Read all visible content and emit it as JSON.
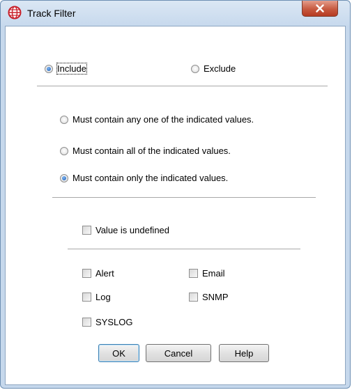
{
  "window": {
    "title": "Track Filter"
  },
  "mode": {
    "include_label": "Include",
    "exclude_label": "Exclude",
    "selected": "Include"
  },
  "match": {
    "options": [
      "Must contain any one of the indicated values.",
      "Must contain all of the indicated values.",
      "Must contain only the indicated values."
    ],
    "selected": "Must contain only the indicated values."
  },
  "undefined_label": "Value is undefined",
  "values": {
    "alert": "Alert",
    "email": "Email",
    "log": "Log",
    "snmp": "SNMP",
    "syslog": "SYSLOG"
  },
  "buttons": {
    "ok": "OK",
    "cancel": "Cancel",
    "help": "Help"
  },
  "icons": {
    "app": "globe-icon",
    "close": "close-icon"
  },
  "colors": {
    "title_bar": "#c7d9ed",
    "close_button": "#c75a40",
    "radio_dot": "#1c5fb8"
  }
}
